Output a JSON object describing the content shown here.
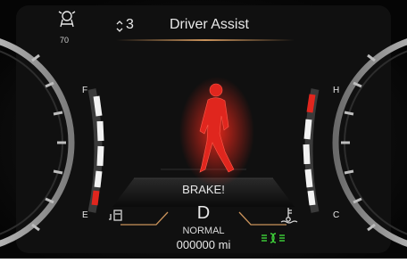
{
  "header": {
    "title": "Driver Assist",
    "page_index": "3",
    "speed_limit": "70"
  },
  "alert": {
    "message": "BRAKE!",
    "figure_color": "#e0261e"
  },
  "drivetrain": {
    "gear": "D",
    "mode": "NORMAL",
    "odometer": "000000 mi"
  },
  "gauges": {
    "fuel": {
      "full_label": "F",
      "empty_label": "E",
      "icon": "fuel-pump-icon"
    },
    "temperature": {
      "hot_label": "H",
      "cold_label": "C",
      "icon": "coolant-temperature-icon"
    }
  },
  "indicators": {
    "lights_icon": "parking-lights-icon",
    "lights_color": "#3fd23a",
    "driver_assist_icon": "driver-assist-icon"
  },
  "colors": {
    "accent": "#c9925a",
    "warning": "#e0261e",
    "background": "#0c0c0c"
  }
}
